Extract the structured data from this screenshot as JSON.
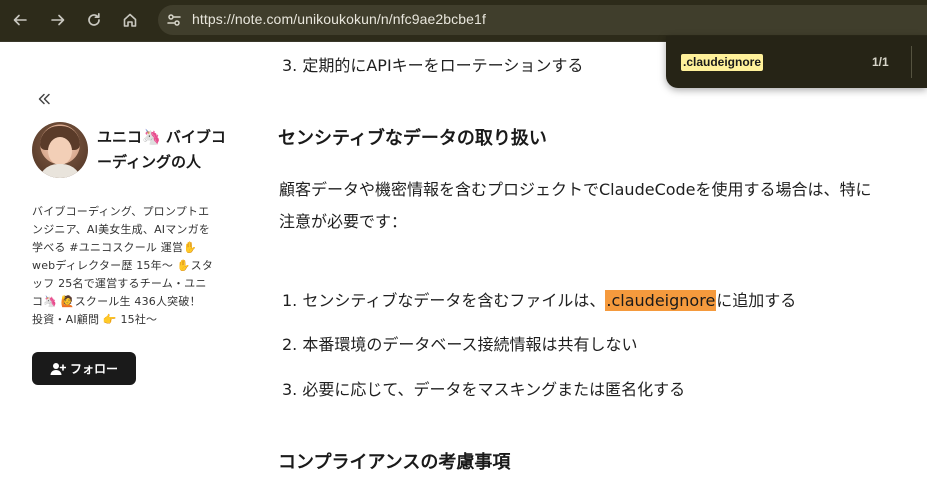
{
  "browser": {
    "url": "https://note.com/unikoukokun/n/nfc9ae2bcbe1f"
  },
  "find_bar": {
    "query": ".claudeignore",
    "count": "1/1"
  },
  "sidebar": {
    "author_name": "ユニコ🦄 バイブコーディングの人",
    "bio": "バイブコーディング、プロンプトエンジニア、AI美女生成、AIマンガを学べる #ユニコスクール 運営✋ webディレクター歴 15年〜 ✋スタッフ 25名で運営するチーム・ユニコ🦄 🙋スクール生 436人突破！ 投資・AI顧問 👉 15社〜",
    "follow_label": "フォロー"
  },
  "article": {
    "item_rotate": "3. 定期的にAPIキーをローテーションする",
    "heading_sensitive": "センシティブなデータの取り扱い",
    "para_sensitive": "顧客データや機密情報を含むプロジェクトでClaudeCodeを使用する場合は、特に注意が必要です：",
    "item1_before": "1. センシティブなデータを含むファイルは、",
    "item1_highlight": ".claudeignore",
    "item1_after": "に追加する",
    "item2": "2. 本番環境のデータベース接続情報は共有しない",
    "item3": "3. 必要に応じて、データをマスキングまたは匿名化する",
    "heading_compliance": "コンプライアンスの考慮事項"
  },
  "colors": {
    "chrome_bg": "#2d2b1a",
    "find_highlight": "#fff19a",
    "page_highlight": "#f59a3d",
    "follow_button": "#1a1a1a"
  }
}
